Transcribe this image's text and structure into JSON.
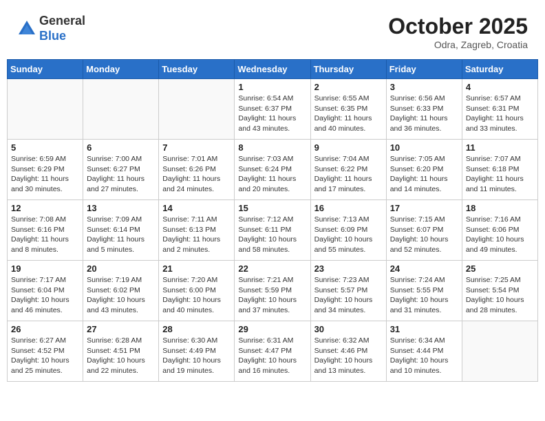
{
  "header": {
    "logo_general": "General",
    "logo_blue": "Blue",
    "month": "October 2025",
    "location": "Odra, Zagreb, Croatia"
  },
  "days_of_week": [
    "Sunday",
    "Monday",
    "Tuesday",
    "Wednesday",
    "Thursday",
    "Friday",
    "Saturday"
  ],
  "weeks": [
    [
      {
        "day": "",
        "info": ""
      },
      {
        "day": "",
        "info": ""
      },
      {
        "day": "",
        "info": ""
      },
      {
        "day": "1",
        "info": "Sunrise: 6:54 AM\nSunset: 6:37 PM\nDaylight: 11 hours and 43 minutes."
      },
      {
        "day": "2",
        "info": "Sunrise: 6:55 AM\nSunset: 6:35 PM\nDaylight: 11 hours and 40 minutes."
      },
      {
        "day": "3",
        "info": "Sunrise: 6:56 AM\nSunset: 6:33 PM\nDaylight: 11 hours and 36 minutes."
      },
      {
        "day": "4",
        "info": "Sunrise: 6:57 AM\nSunset: 6:31 PM\nDaylight: 11 hours and 33 minutes."
      }
    ],
    [
      {
        "day": "5",
        "info": "Sunrise: 6:59 AM\nSunset: 6:29 PM\nDaylight: 11 hours and 30 minutes."
      },
      {
        "day": "6",
        "info": "Sunrise: 7:00 AM\nSunset: 6:27 PM\nDaylight: 11 hours and 27 minutes."
      },
      {
        "day": "7",
        "info": "Sunrise: 7:01 AM\nSunset: 6:26 PM\nDaylight: 11 hours and 24 minutes."
      },
      {
        "day": "8",
        "info": "Sunrise: 7:03 AM\nSunset: 6:24 PM\nDaylight: 11 hours and 20 minutes."
      },
      {
        "day": "9",
        "info": "Sunrise: 7:04 AM\nSunset: 6:22 PM\nDaylight: 11 hours and 17 minutes."
      },
      {
        "day": "10",
        "info": "Sunrise: 7:05 AM\nSunset: 6:20 PM\nDaylight: 11 hours and 14 minutes."
      },
      {
        "day": "11",
        "info": "Sunrise: 7:07 AM\nSunset: 6:18 PM\nDaylight: 11 hours and 11 minutes."
      }
    ],
    [
      {
        "day": "12",
        "info": "Sunrise: 7:08 AM\nSunset: 6:16 PM\nDaylight: 11 hours and 8 minutes."
      },
      {
        "day": "13",
        "info": "Sunrise: 7:09 AM\nSunset: 6:14 PM\nDaylight: 11 hours and 5 minutes."
      },
      {
        "day": "14",
        "info": "Sunrise: 7:11 AM\nSunset: 6:13 PM\nDaylight: 11 hours and 2 minutes."
      },
      {
        "day": "15",
        "info": "Sunrise: 7:12 AM\nSunset: 6:11 PM\nDaylight: 10 hours and 58 minutes."
      },
      {
        "day": "16",
        "info": "Sunrise: 7:13 AM\nSunset: 6:09 PM\nDaylight: 10 hours and 55 minutes."
      },
      {
        "day": "17",
        "info": "Sunrise: 7:15 AM\nSunset: 6:07 PM\nDaylight: 10 hours and 52 minutes."
      },
      {
        "day": "18",
        "info": "Sunrise: 7:16 AM\nSunset: 6:06 PM\nDaylight: 10 hours and 49 minutes."
      }
    ],
    [
      {
        "day": "19",
        "info": "Sunrise: 7:17 AM\nSunset: 6:04 PM\nDaylight: 10 hours and 46 minutes."
      },
      {
        "day": "20",
        "info": "Sunrise: 7:19 AM\nSunset: 6:02 PM\nDaylight: 10 hours and 43 minutes."
      },
      {
        "day": "21",
        "info": "Sunrise: 7:20 AM\nSunset: 6:00 PM\nDaylight: 10 hours and 40 minutes."
      },
      {
        "day": "22",
        "info": "Sunrise: 7:21 AM\nSunset: 5:59 PM\nDaylight: 10 hours and 37 minutes."
      },
      {
        "day": "23",
        "info": "Sunrise: 7:23 AM\nSunset: 5:57 PM\nDaylight: 10 hours and 34 minutes."
      },
      {
        "day": "24",
        "info": "Sunrise: 7:24 AM\nSunset: 5:55 PM\nDaylight: 10 hours and 31 minutes."
      },
      {
        "day": "25",
        "info": "Sunrise: 7:25 AM\nSunset: 5:54 PM\nDaylight: 10 hours and 28 minutes."
      }
    ],
    [
      {
        "day": "26",
        "info": "Sunrise: 6:27 AM\nSunset: 4:52 PM\nDaylight: 10 hours and 25 minutes."
      },
      {
        "day": "27",
        "info": "Sunrise: 6:28 AM\nSunset: 4:51 PM\nDaylight: 10 hours and 22 minutes."
      },
      {
        "day": "28",
        "info": "Sunrise: 6:30 AM\nSunset: 4:49 PM\nDaylight: 10 hours and 19 minutes."
      },
      {
        "day": "29",
        "info": "Sunrise: 6:31 AM\nSunset: 4:47 PM\nDaylight: 10 hours and 16 minutes."
      },
      {
        "day": "30",
        "info": "Sunrise: 6:32 AM\nSunset: 4:46 PM\nDaylight: 10 hours and 13 minutes."
      },
      {
        "day": "31",
        "info": "Sunrise: 6:34 AM\nSunset: 4:44 PM\nDaylight: 10 hours and 10 minutes."
      },
      {
        "day": "",
        "info": ""
      }
    ]
  ]
}
